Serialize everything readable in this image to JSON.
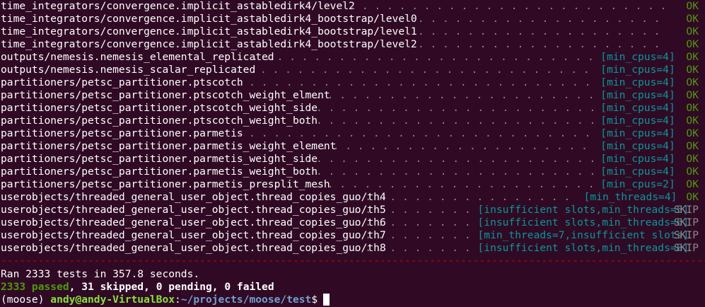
{
  "terminal": {
    "results": [
      {
        "name": "time_integrators/convergence.implicit_astabledirk4/level2",
        "caveat": "",
        "status": "OK"
      },
      {
        "name": "time_integrators/convergence.implicit_astabledirk4_bootstrap/level0",
        "caveat": "",
        "status": "OK"
      },
      {
        "name": "time_integrators/convergence.implicit_astabledirk4_bootstrap/level1",
        "caveat": "",
        "status": "OK"
      },
      {
        "name": "time_integrators/convergence.implicit_astabledirk4_bootstrap/level2",
        "caveat": "",
        "status": "OK"
      },
      {
        "name": "outputs/nemesis.nemesis_elemental_replicated",
        "caveat": "[min_cpus=4]",
        "status": "OK"
      },
      {
        "name": "outputs/nemesis.nemesis_scalar_replicated",
        "caveat": "[min_cpus=4]",
        "status": "OK"
      },
      {
        "name": "partitioners/petsc_partitioner.ptscotch",
        "caveat": "[min_cpus=4]",
        "status": "OK"
      },
      {
        "name": "partitioners/petsc_partitioner.ptscotch_weight_elment",
        "caveat": "[min_cpus=4]",
        "status": "OK"
      },
      {
        "name": "partitioners/petsc_partitioner.ptscotch_weight_side",
        "caveat": "[min_cpus=4]",
        "status": "OK"
      },
      {
        "name": "partitioners/petsc_partitioner.ptscotch_weight_both",
        "caveat": "[min_cpus=4]",
        "status": "OK"
      },
      {
        "name": "partitioners/petsc_partitioner.parmetis",
        "caveat": "[min_cpus=4]",
        "status": "OK"
      },
      {
        "name": "partitioners/petsc_partitioner.parmetis_weight_element",
        "caveat": "[min_cpus=4]",
        "status": "OK"
      },
      {
        "name": "partitioners/petsc_partitioner.parmetis_weight_side",
        "caveat": "[min_cpus=4]",
        "status": "OK"
      },
      {
        "name": "partitioners/petsc_partitioner.parmetis_weight_both",
        "caveat": "[min_cpus=4]",
        "status": "OK"
      },
      {
        "name": "partitioners/petsc_partitioner.parmetis_presplit_mesh",
        "caveat": "[min_cpus=2]",
        "status": "OK"
      },
      {
        "name": "userobjects/threaded_general_user_object.thread_copies_guo/th4",
        "caveat": "[min_threads=4]",
        "status": "OK"
      },
      {
        "name": "userobjects/threaded_general_user_object.thread_copies_guo/th5",
        "caveat": "[insufficient slots,min_threads=5]",
        "status": "SKIP"
      },
      {
        "name": "userobjects/threaded_general_user_object.thread_copies_guo/th6",
        "caveat": "[insufficient slots,min_threads=6]",
        "status": "SKIP"
      },
      {
        "name": "userobjects/threaded_general_user_object.thread_copies_guo/th7",
        "caveat": "[min_threads=7,insufficient slots]",
        "status": "SKIP"
      },
      {
        "name": "userobjects/threaded_general_user_object.thread_copies_guo/th8",
        "caveat": "[insufficient slots,min_threads=8]",
        "status": "SKIP"
      }
    ],
    "separator": "------------------------------------------------------------------------------------------------------------------------------------------------------------------------------------------------",
    "summary": {
      "ran_line": "Ran 2333 tests in 357.8 seconds.",
      "passed": "2333 passed",
      "comma1": ", ",
      "skipped": "31 skipped",
      "comma2": ", ",
      "pending": "0 pending",
      "comma3": ", ",
      "failed": "0 failed"
    },
    "prompt": {
      "env": "(moose) ",
      "user_host": "andy@andy-VirtualBox",
      "colon": ":",
      "path": "~/projects/moose/test",
      "symbol": "$"
    },
    "colors": {
      "background": "#300a24",
      "ok": "#4e9a06",
      "caveat": "#06989a",
      "separator": "#cc0000",
      "user": "#8ae234",
      "path": "#729fcf"
    }
  }
}
